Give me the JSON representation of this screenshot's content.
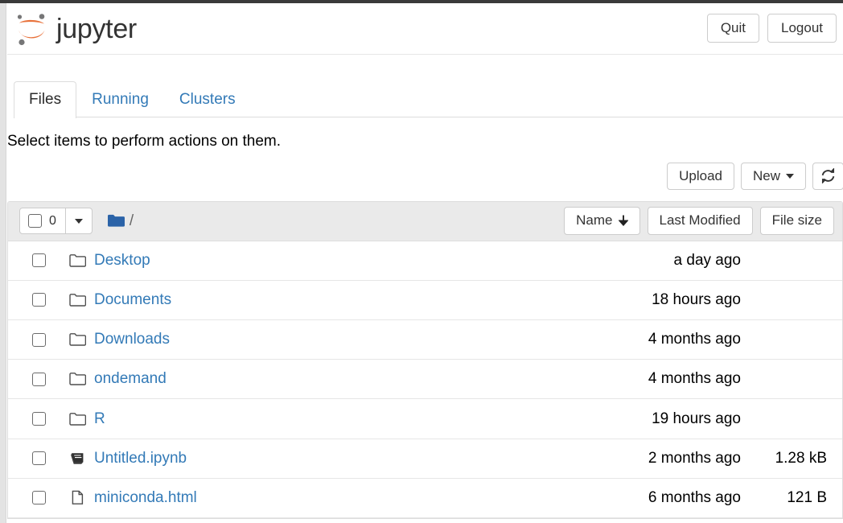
{
  "header": {
    "brand": "jupyter",
    "logo_icon": "jupyter-logo",
    "quit_label": "Quit",
    "logout_label": "Logout"
  },
  "tabs": [
    {
      "label": "Files",
      "active": true
    },
    {
      "label": "Running",
      "active": false
    },
    {
      "label": "Clusters",
      "active": false
    }
  ],
  "notice": "Select items to perform actions on them.",
  "toolbar": {
    "upload_label": "Upload",
    "new_label": "New",
    "new_caret_icon": "caret-down-icon",
    "refresh_icon": "refresh-icon"
  },
  "list_header": {
    "select_all_checkbox_icon": "checkbox-unchecked-icon",
    "selected_count": "0",
    "select_dropdown_icon": "caret-down-icon",
    "folder_icon": "folder-filled-icon",
    "breadcrumb_root": "/",
    "columns": [
      {
        "label": "Name",
        "sort_icon": "arrow-down-icon"
      },
      {
        "label": "Last Modified",
        "sort_icon": ""
      },
      {
        "label": "File size",
        "sort_icon": ""
      }
    ]
  },
  "files": [
    {
      "checkbox_icon": "checkbox-unchecked-icon",
      "icon": "folder-outline-icon",
      "type": "folder",
      "name": "Desktop",
      "modified": "a day ago",
      "size": ""
    },
    {
      "checkbox_icon": "checkbox-unchecked-icon",
      "icon": "folder-outline-icon",
      "type": "folder",
      "name": "Documents",
      "modified": "18 hours ago",
      "size": ""
    },
    {
      "checkbox_icon": "checkbox-unchecked-icon",
      "icon": "folder-outline-icon",
      "type": "folder",
      "name": "Downloads",
      "modified": "4 months ago",
      "size": ""
    },
    {
      "checkbox_icon": "checkbox-unchecked-icon",
      "icon": "folder-outline-icon",
      "type": "folder",
      "name": "ondemand",
      "modified": "4 months ago",
      "size": ""
    },
    {
      "checkbox_icon": "checkbox-unchecked-icon",
      "icon": "folder-outline-icon",
      "type": "folder",
      "name": "R",
      "modified": "19 hours ago",
      "size": ""
    },
    {
      "checkbox_icon": "checkbox-unchecked-icon",
      "icon": "notebook-icon",
      "type": "notebook",
      "name": "Untitled.ipynb",
      "modified": "2 months ago",
      "size": "1.28 kB"
    },
    {
      "checkbox_icon": "checkbox-unchecked-icon",
      "icon": "file-icon",
      "type": "file",
      "name": "miniconda.html",
      "modified": "6 months ago",
      "size": "121 B"
    }
  ],
  "colors": {
    "link": "#337ab7",
    "logo_orange": "#e8713a",
    "logo_gray": "#767677",
    "header_bg": "#eaeaea",
    "border": "#dddddd"
  }
}
